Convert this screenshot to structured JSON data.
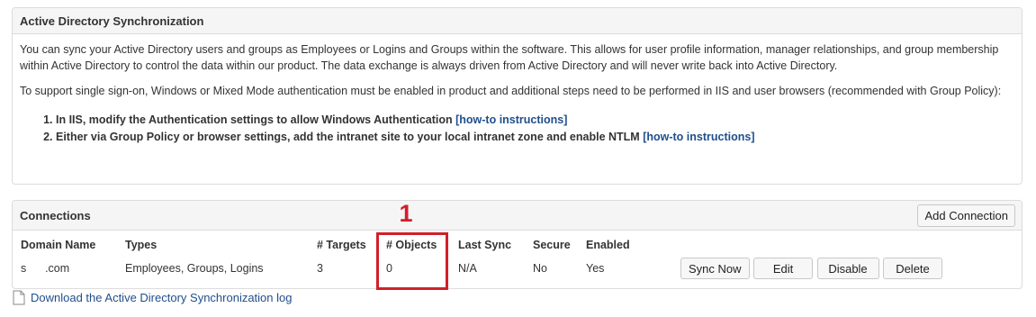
{
  "ad_panel": {
    "title": "Active Directory Synchronization",
    "paragraph1": "You can sync your Active Directory users and groups as Employees or Logins and Groups within the software. This allows for user profile information, manager relationships, and group membership within Active Directory to control the data within our product. The data exchange is always driven from Active Directory and will never write back into Active Directory.",
    "paragraph2": "To support single sign-on, Windows or Mixed Mode authentication must be enabled in product and additional steps need to be performed in IIS and user browsers (recommended with Group Policy):",
    "steps": [
      {
        "text": "In IIS, modify the Authentication settings to allow Windows Authentication ",
        "link": "[how-to instructions]"
      },
      {
        "text": "Either via Group Policy or browser settings, add the intranet site to your local intranet zone and enable NTLM ",
        "link": "[how-to instructions]"
      }
    ]
  },
  "connections": {
    "title": "Connections",
    "add_label": "Add Connection",
    "columns": [
      "Domain Name",
      "Types",
      "# Targets",
      "# Objects",
      "Last Sync",
      "Secure",
      "Enabled"
    ],
    "rows": [
      {
        "domain": "s      .com",
        "types": "Employees, Groups, Logins",
        "targets": "3",
        "objects": "0",
        "last_sync": "N/A",
        "secure": "No",
        "enabled": "Yes",
        "actions": {
          "sync_now": "Sync Now",
          "edit": "Edit",
          "disable": "Disable",
          "delete": "Delete"
        }
      }
    ]
  },
  "annotation": {
    "number": "1",
    "color": "#d0202a"
  },
  "download": {
    "label": "Download the Active Directory Synchronization log",
    "icon": "file-icon"
  }
}
